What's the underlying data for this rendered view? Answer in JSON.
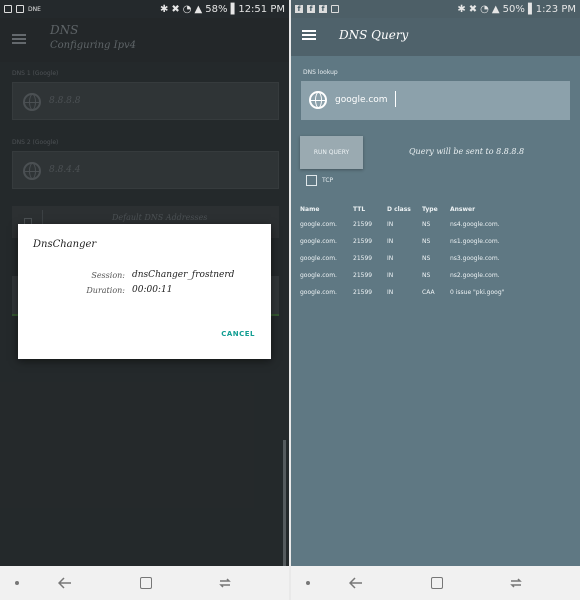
{
  "left": {
    "status": {
      "right_text": "58% ▌12:51 PM",
      "left_text": "DNE"
    },
    "app_title": "DNS",
    "app_subtitle": "Configuring Ipv4",
    "dns1_label": "DNS 1 (Google)",
    "dns1_value": "8.8.8.8",
    "dns2_label": "DNS 2 (Google)",
    "dns2_value": "8.8.4.4",
    "default_dns_label": "Default DNS Addresses",
    "dialog": {
      "title": "DnsChanger",
      "session_key": "Session:",
      "session_value": "dnsChanger_frostnerd",
      "duration_key": "Duration:",
      "duration_value": "00:00:11",
      "cancel_label": "CANCEL"
    }
  },
  "right": {
    "status": {
      "right_text": "50% ▌1:23 PM"
    },
    "app_title": "DNS Query",
    "lookup_label": "DNS lookup",
    "lookup_value": "google.com",
    "run_button": "RUN QUERY",
    "query_info": "Query will be sent to 8.8.8.8",
    "tcp_label": "TCP",
    "table": {
      "headers": [
        "Name",
        "TTL",
        "D class",
        "Type",
        "Answer"
      ],
      "rows": [
        [
          "google.com.",
          "21599",
          "IN",
          "NS",
          "ns4.google.com."
        ],
        [
          "google.com.",
          "21599",
          "IN",
          "NS",
          "ns1.google.com."
        ],
        [
          "google.com.",
          "21599",
          "IN",
          "NS",
          "ns3.google.com."
        ],
        [
          "google.com.",
          "21599",
          "IN",
          "NS",
          "ns2.google.com."
        ],
        [
          "google.com.",
          "21599",
          "IN",
          "CAA",
          "0 issue \"pki.goog\""
        ]
      ]
    }
  },
  "colors": {
    "left_bg": "#2d3235",
    "right_bg": "#5f7883",
    "accent": "#139e93"
  }
}
